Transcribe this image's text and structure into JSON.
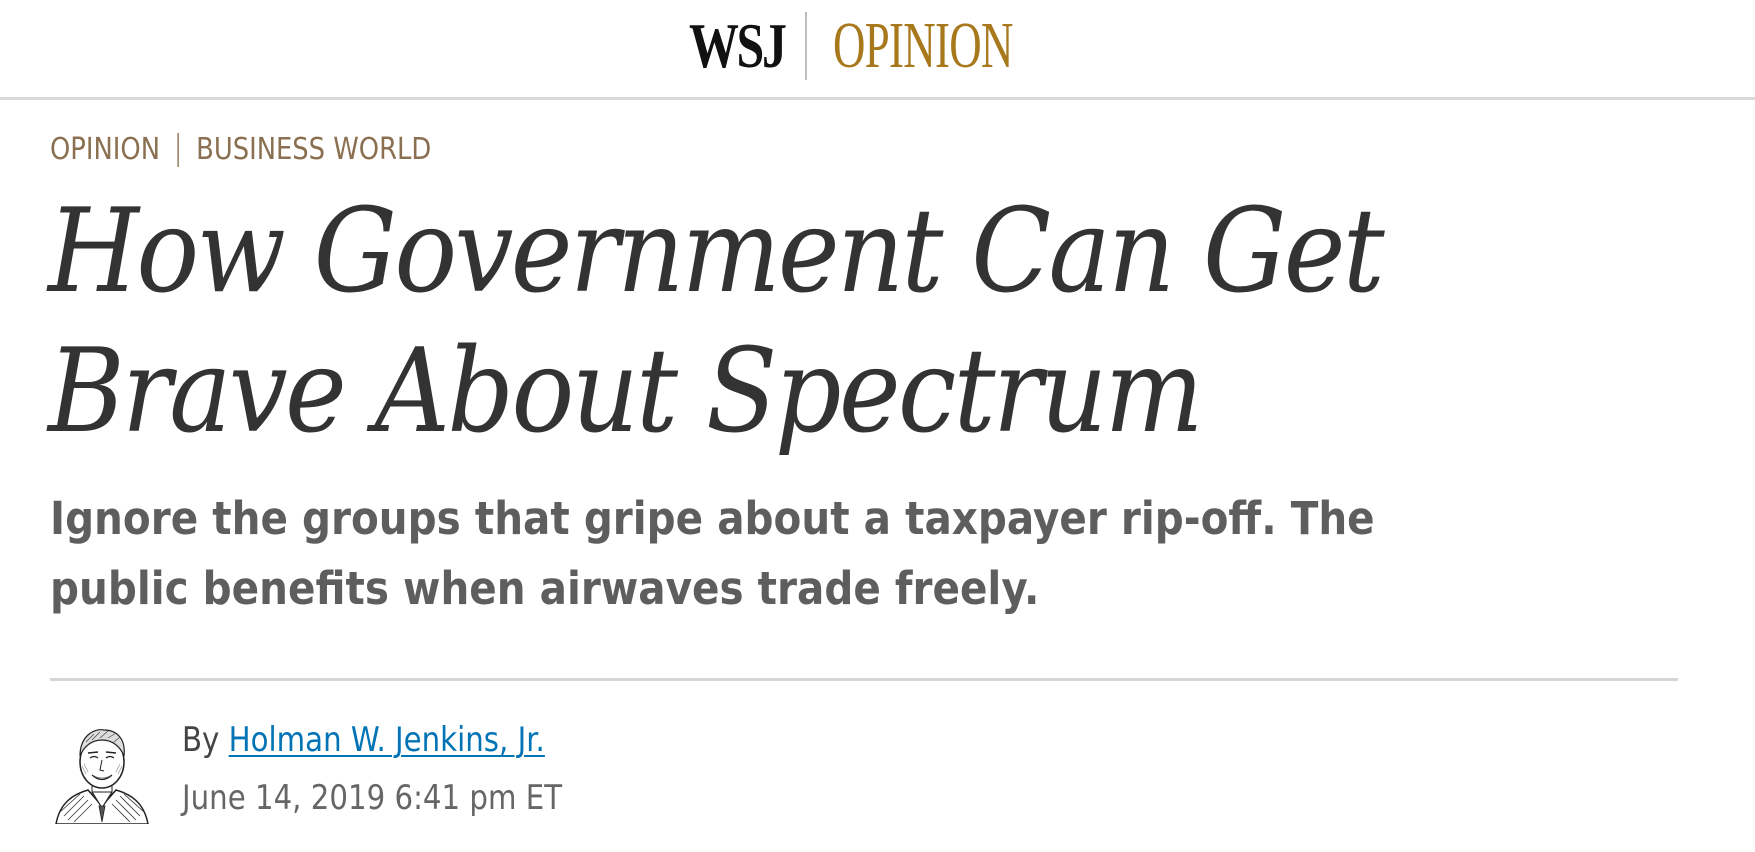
{
  "masthead": {
    "brand": "WSJ",
    "section": "OPINION"
  },
  "flashline": {
    "section": "OPINION",
    "column": "BUSINESS WORLD"
  },
  "article": {
    "headline": "How Government Can Get Brave About Spectrum",
    "dek": "Ignore the groups that gripe about a taxpayer rip-off. The public benefits when airwaves trade freely.",
    "byline_prefix": "By",
    "author": "Holman W. Jenkins, Jr.",
    "timestamp": "June 14, 2019 6:41 pm ET",
    "author_avatar_icon": "author-portrait-sketch"
  },
  "colors": {
    "opinion_gold": "#a8781c",
    "flashline_brown": "#8a7050",
    "link_blue": "#0274b6",
    "headline_text": "#333333"
  }
}
